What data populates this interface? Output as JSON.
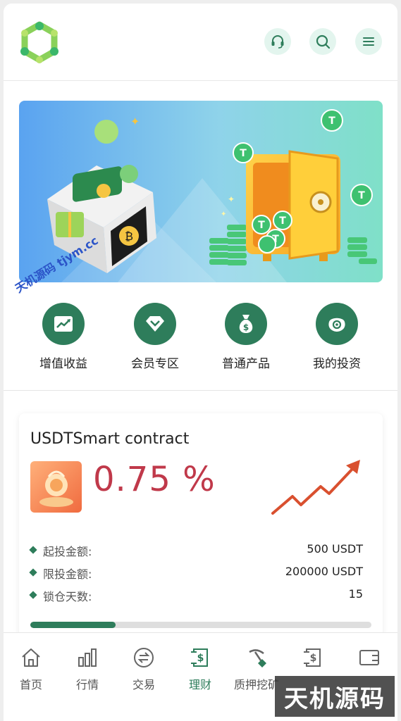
{
  "header": {
    "logo_icon": "hex-logo",
    "actions": [
      "headset-icon",
      "search-icon",
      "menu-icon"
    ]
  },
  "quick_actions": [
    {
      "label": "增值收益",
      "icon": "chart-up-icon"
    },
    {
      "label": "会员专区",
      "icon": "diamond-icon"
    },
    {
      "label": "普通产品",
      "icon": "money-bag-icon"
    },
    {
      "label": "我的投资",
      "icon": "coin-wallet-icon"
    }
  ],
  "product": {
    "title": "USDTSmart contract",
    "rate": "0.75 %",
    "rows": [
      {
        "key": "起投金额:",
        "value": "500 USDT"
      },
      {
        "key": "限投金额:",
        "value": "200000 USDT"
      },
      {
        "key": "锁仓天数:",
        "value": "15"
      }
    ],
    "progress": 0.25
  },
  "nav": [
    {
      "label": "首页",
      "icon": "home-icon",
      "active": false
    },
    {
      "label": "行情",
      "icon": "bar-chart-icon",
      "active": false
    },
    {
      "label": "交易",
      "icon": "exchange-icon",
      "active": false
    },
    {
      "label": "理财",
      "icon": "finance-icon",
      "active": true
    },
    {
      "label": "质押挖矿",
      "icon": "pickaxe-icon",
      "active": false
    },
    {
      "label": "",
      "icon": "transfer-icon",
      "active": false
    },
    {
      "label": "",
      "icon": "wallet-icon",
      "active": false
    }
  ],
  "watermark": {
    "diagonal": "天机源码 tjym.cc",
    "box": "天机源码"
  },
  "colors": {
    "primary": "#2e7d5b",
    "rate": "#c0394a",
    "light_green": "#e3f5ee"
  }
}
